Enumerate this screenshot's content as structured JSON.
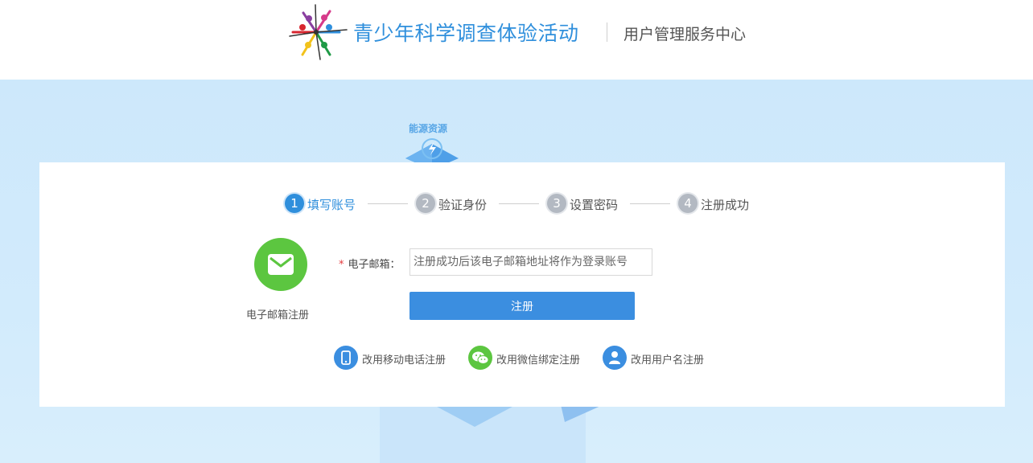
{
  "header": {
    "site_title": "青少年科学调查体验活动",
    "subtitle": "用户管理服务中心"
  },
  "banner": {
    "decoration_label": "能源资源"
  },
  "steps": [
    {
      "number": "1",
      "label": "填写账号",
      "active": true
    },
    {
      "number": "2",
      "label": "验证身份",
      "active": false
    },
    {
      "number": "3",
      "label": "设置密码",
      "active": false
    },
    {
      "number": "4",
      "label": "注册成功",
      "active": false
    }
  ],
  "registration": {
    "method_icon": "envelope-icon",
    "method_label": "电子邮箱注册",
    "required_mark": "*",
    "email_label": "电子邮箱：",
    "email_value": "",
    "email_placeholder": "注册成功后该电子邮箱地址将作为登录账号",
    "submit_label": "注册"
  },
  "alternatives": [
    {
      "icon": "mobile-phone-icon",
      "label": "改用移动电话注册"
    },
    {
      "icon": "wechat-icon",
      "label": "改用微信绑定注册"
    },
    {
      "icon": "user-icon",
      "label": "改用用户名注册"
    }
  ],
  "colors": {
    "accent": "#2f8fdc",
    "button": "#3b8ee0",
    "email_green": "#5cc640",
    "wechat_green": "#5cc640",
    "banner_bg": "#cde8fb",
    "required": "#e4393c"
  }
}
